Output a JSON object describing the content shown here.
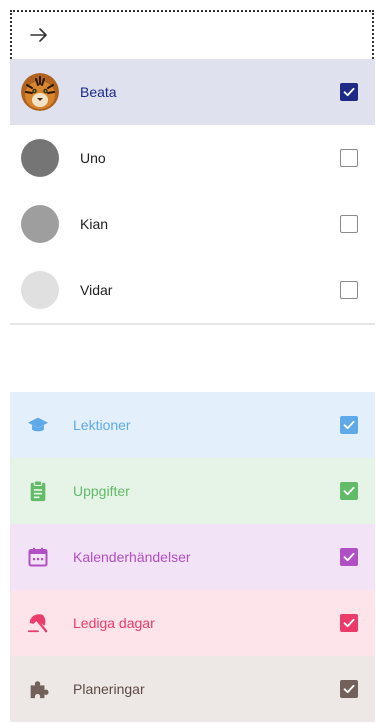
{
  "header": {
    "back_icon": "arrow-right-icon"
  },
  "people": [
    {
      "name": "Beata",
      "avatar": "tiger-photo",
      "selected": true,
      "checked": true,
      "check_color": "#1f2a86",
      "row_color": "#dfe1ee"
    },
    {
      "name": "Uno",
      "avatar_color": "#757575",
      "selected": false,
      "checked": false
    },
    {
      "name": "Kian",
      "avatar_color": "#9e9e9e",
      "selected": false,
      "checked": false
    },
    {
      "name": "Vidar",
      "avatar_color": "#e0e0e0",
      "selected": false,
      "checked": false
    }
  ],
  "categories": [
    {
      "label": "Lektioner",
      "icon": "graduation-cap-icon",
      "color": "#5ea9e8",
      "bg": "#e3f0fc",
      "checked": true
    },
    {
      "label": "Uppgifter",
      "icon": "clipboard-icon",
      "color": "#62bb68",
      "bg": "#e6f4e7",
      "checked": true
    },
    {
      "label": "Kalenderhändelser",
      "icon": "calendar-icon",
      "color": "#b14fc4",
      "bg": "#f3e3f7",
      "checked": true
    },
    {
      "label": "Lediga dagar",
      "icon": "beach-umbrella-icon",
      "color": "#ea3b6a",
      "bg": "#fce4ea",
      "checked": true
    },
    {
      "label": "Planeringar",
      "icon": "puzzle-icon",
      "color": "#74605a",
      "bg": "#ede8e6",
      "checked": true
    }
  ]
}
